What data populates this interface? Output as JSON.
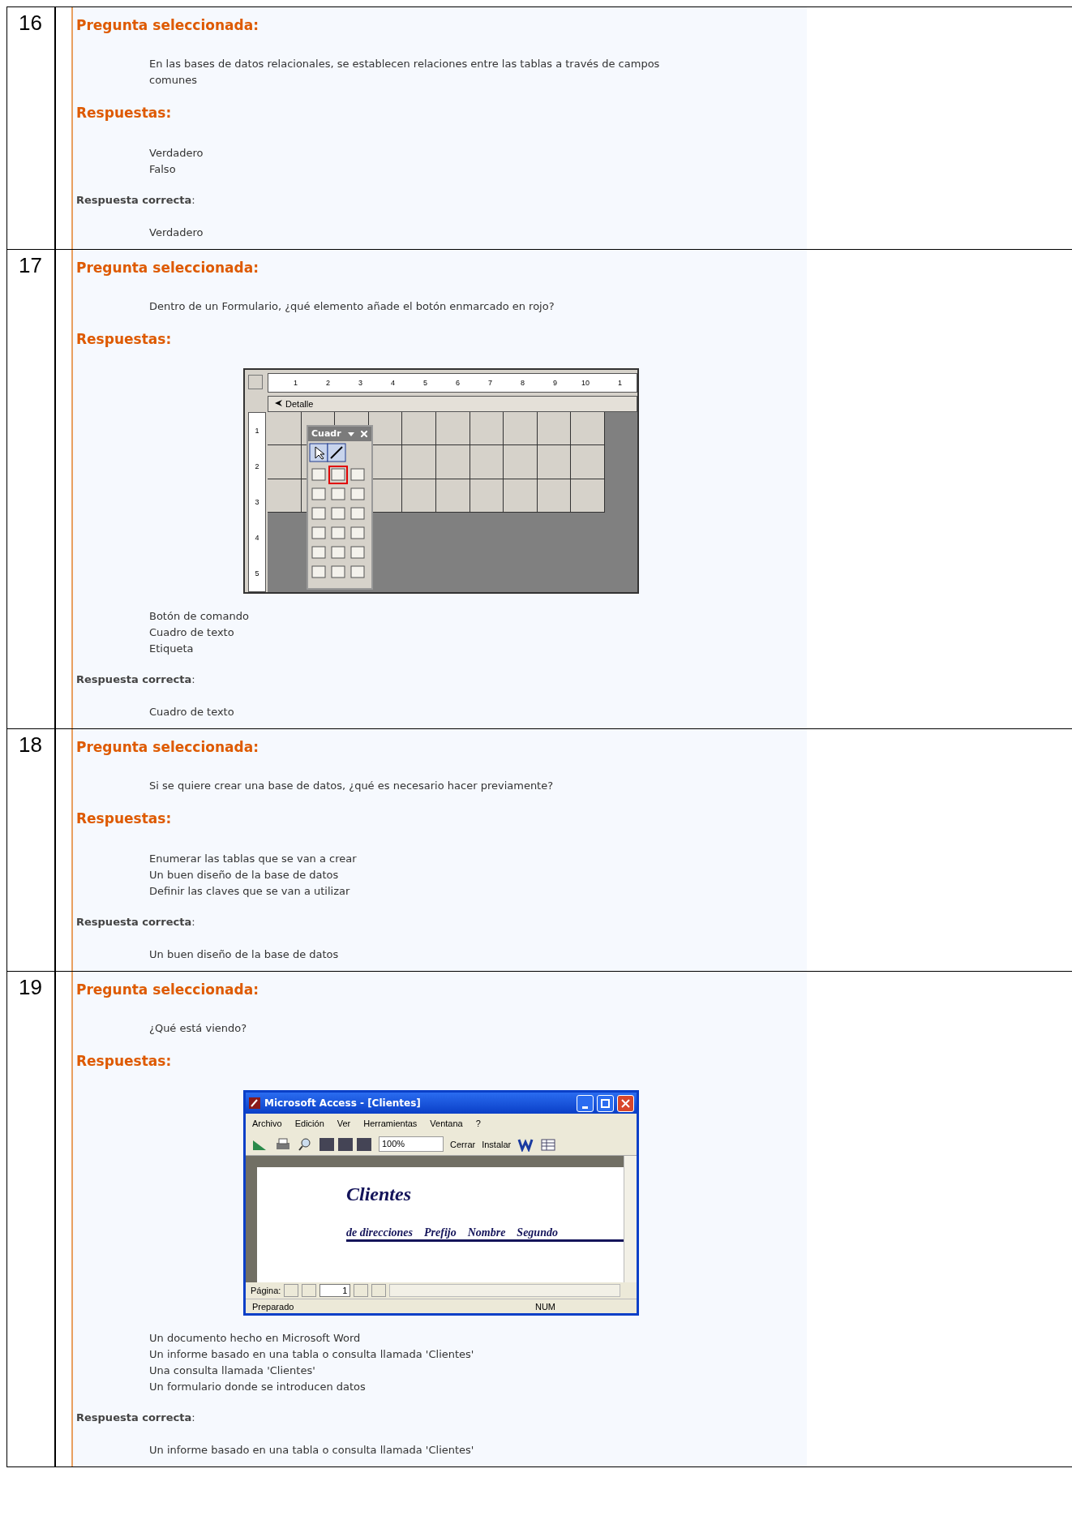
{
  "questions": [
    {
      "number": "16",
      "heading": "Pregunta seleccionada:",
      "question": "En las bases de datos relacionales, se establecen relaciones entre las tablas a través de campos comunes",
      "answers_heading": "Respuestas:",
      "answers": [
        "Verdadero",
        "Falso"
      ],
      "correct_label": "**Respuesta correcta**:",
      "correct_answer": "Verdadero"
    },
    {
      "number": "17",
      "heading": "Pregunta seleccionada:",
      "question": "Dentro de un Formulario, ¿qué elemento añade el botón enmarcado en rojo?",
      "answers_heading": "Respuestas:",
      "figure": {
        "kind": "form_designer",
        "ruler_marks": [
          "1",
          "2",
          "3",
          "4",
          "5",
          "6",
          "7",
          "8",
          "9",
          "10",
          "1"
        ],
        "side_marks": [
          "1",
          "2",
          "3",
          "4",
          "5"
        ],
        "section": "Detalle",
        "toolbox_title": "Cuadr"
      },
      "answers": [
        "Botón de comando",
        "Cuadro de texto",
        "Etiqueta"
      ],
      "correct_label": "**Respuesta correcta**:",
      "correct_answer": "Cuadro de texto"
    },
    {
      "number": "18",
      "heading": "Pregunta seleccionada:",
      "question": "Si se quiere crear una base de datos, ¿qué es necesario hacer previamente?",
      "answers_heading": "Respuestas:",
      "answers": [
        "Enumerar las tablas que se van a crear",
        "Un buen diseño de la base de datos",
        "Definir las claves que se van a utilizar"
      ],
      "correct_label": "**Respuesta correcta**:",
      "correct_answer": "Un buen diseño de la base de datos"
    },
    {
      "number": "19",
      "heading": "Pregunta seleccionada:",
      "question": "¿Qué está viendo?",
      "answers_heading": "Respuestas:",
      "figure": {
        "kind": "access_report",
        "title": "Microsoft Access - [Clientes]",
        "menu": [
          "Archivo",
          "Edición",
          "Ver",
          "Herramientas",
          "Ventana",
          "?"
        ],
        "zoom": "100%",
        "toolbar_buttons": [
          "Cerrar",
          "Instalar"
        ],
        "report_title": "Clientes",
        "columns": [
          "de direcciones",
          "Prefijo",
          "Nombre",
          "Segundo"
        ],
        "page_label": "Página:",
        "page": "1",
        "status": "Preparado",
        "indicator": "NUM"
      },
      "answers": [
        "Un documento hecho en Microsoft Word",
        "Un informe basado en una tabla o consulta llamada 'Clientes'",
        "Una consulta llamada 'Clientes'",
        "Un formulario donde se introducen datos"
      ],
      "correct_label": "**Respuesta correcta**:",
      "correct_answer": "Un informe basado en una tabla o consulta llamada 'Clientes'"
    }
  ]
}
